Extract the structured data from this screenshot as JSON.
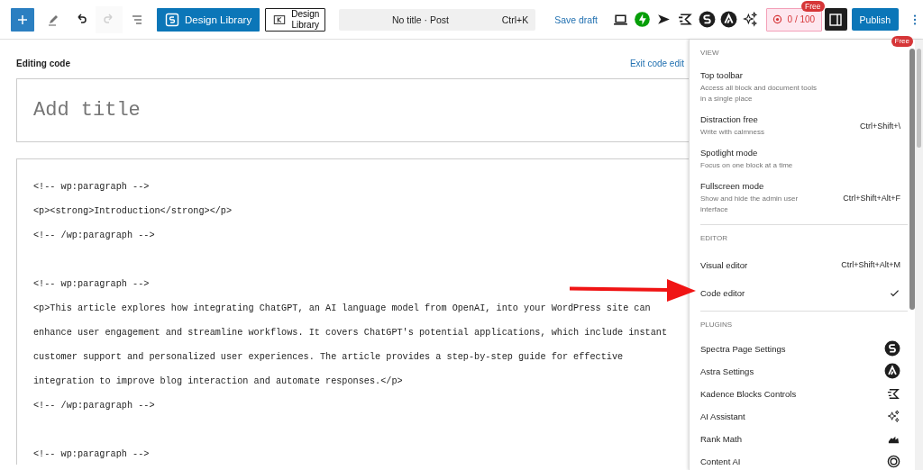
{
  "toolbar": {
    "tools": [
      {
        "kind": "inserter",
        "disabled": false
      },
      {
        "kind": "pencil",
        "disabled": false
      },
      {
        "kind": "undo",
        "disabled": false
      },
      {
        "kind": "redo",
        "disabled": true
      },
      {
        "kind": "list",
        "disabled": false
      }
    ],
    "design_library_buttons": [
      {
        "kind": "primary",
        "label": "Design Library"
      },
      {
        "kind": "outline",
        "label": "Design Library"
      }
    ],
    "command_bar": {
      "title": "No title · Post",
      "shortcut": "Ctrl+K"
    },
    "save_draft": "Save draft",
    "word_counter": {
      "value": "0 / 100",
      "badge": "Free"
    },
    "sidebar_toggle": {
      "pressed": true
    },
    "publish": "Publish"
  },
  "editor": {
    "heading": "Editing code",
    "exit_link": "Exit code edit",
    "title_placeholder": "Add title",
    "code_blocks": [
      [
        "<!-- wp:paragraph -->",
        "<p><strong>Introduction</strong></p>",
        "<!-- /wp:paragraph -->"
      ],
      [
        "<!-- wp:paragraph -->",
        "<p>This article explores how integrating ChatGPT, an AI language model from OpenAI, into your WordPress site can",
        "enhance user engagement and streamline workflows. It covers ChatGPT's potential applications, which include instant",
        "customer support and personalized user experiences. The article provides a step-by-step guide for effective",
        "integration to improve blog interaction and automate responses.</p>",
        "<!-- /wp:paragraph -->"
      ],
      [
        "<!-- wp:paragraph -->"
      ]
    ]
  },
  "options_menu": {
    "badge": "Free",
    "sections": [
      {
        "kind": "options",
        "heading": "VIEW",
        "items": [
          {
            "label": "Top toolbar",
            "description": "Access all block and document tools in a single place"
          },
          {
            "label": "Distraction free",
            "description": "Write with calmness",
            "shortcut": "Ctrl+Shift+\\"
          },
          {
            "label": "Spotlight mode",
            "description": "Focus on one block at a time"
          },
          {
            "label": "Fullscreen mode",
            "description": "Show and hide the admin user interface",
            "shortcut": "Ctrl+Shift+Alt+F"
          }
        ]
      },
      {
        "kind": "modes",
        "heading": "EDITOR",
        "items": [
          {
            "label": "Visual editor",
            "shortcut": "Ctrl+Shift+Alt+M",
            "selected": false
          },
          {
            "label": "Code editor",
            "selected": true
          }
        ]
      },
      {
        "kind": "plugins",
        "heading": "PLUGINS",
        "items": [
          {
            "label": "Spectra Page Settings"
          },
          {
            "label": "Astra Settings"
          },
          {
            "label": "Kadence Blocks Controls"
          },
          {
            "label": "AI Assistant"
          },
          {
            "label": "Rank Math"
          },
          {
            "label": "Content AI"
          }
        ]
      }
    ]
  }
}
